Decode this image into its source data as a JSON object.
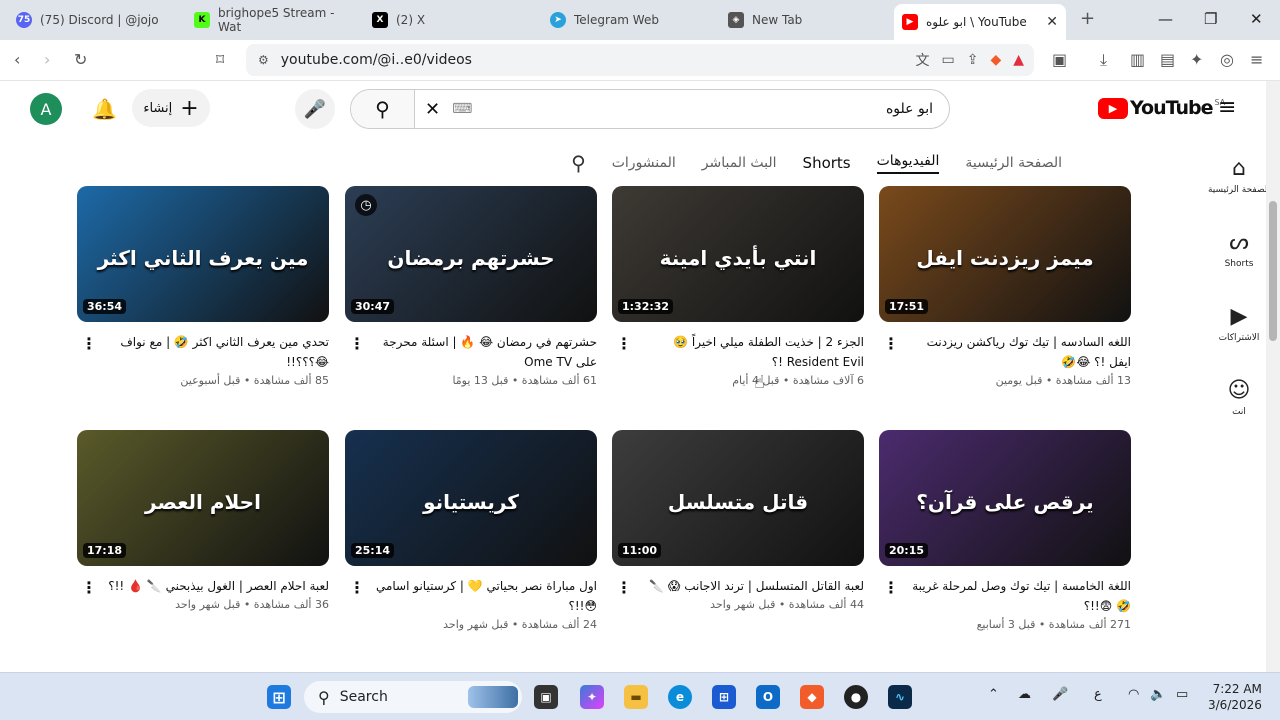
{
  "browser": {
    "tabs": [
      {
        "label": "(75) Discord | @jojo",
        "color": "#5865f2",
        "glyph": "75"
      },
      {
        "label": "brighope5 Stream - Wat",
        "color": "#1c1c1c",
        "glyph": "K"
      },
      {
        "label": "(2) X",
        "color": "#000000",
        "glyph": "X"
      },
      {
        "label": "Telegram Web",
        "color": "#2aa1da",
        "glyph": "➤"
      },
      {
        "label": "New Tab",
        "color": "#555555",
        "glyph": "◈"
      },
      {
        "label": "ابو علوه \\ YouTube",
        "color": "#ff0000",
        "glyph": "▶"
      }
    ],
    "url": "youtube.com/@i..e0/videos",
    "new_tab_glyph": "+"
  },
  "youtube": {
    "logo": "YouTube",
    "region": "SA",
    "search_value": "ابو علوه",
    "create_label": "إنشاء",
    "avatar_letter": "A",
    "channel_tabs": [
      "الصفحة الرئيسية",
      "الفيديوهات",
      "Shorts",
      "البث المباشر",
      "المنشورات"
    ],
    "sidebar": [
      {
        "label": "الصفحة الرئيسية",
        "icon": "⌂"
      },
      {
        "label": "Shorts",
        "icon": "ᔕ"
      },
      {
        "label": "الاشتراكات",
        "icon": "▶"
      },
      {
        "label": "انت",
        "icon": "☺"
      }
    ],
    "videos": [
      {
        "title": "اللغه السادسه | تيك توك رياكشن ريزدنت ايفل !؟ 😂🤣",
        "meta": "13 ألف مشاهدة • قبل يومين",
        "duration": "17:51",
        "overlay": "ميمز ريزدنت ايفل",
        "bg": "#7a4a1c"
      },
      {
        "title": "الجزء 2 | خذيت الطفلة ميلي اخيراً 🥹 Resident Evil !؟",
        "meta": "6 آلاف مشاهدة • قبل 4 أيام",
        "duration": "1:32:32",
        "overlay": "انتي بأيدي امينة",
        "bg": "#3e3a34"
      },
      {
        "title": "حشرتهم في رمضان 😂 🔥 | اسئلة محرجة على Ome TV",
        "meta": "61 ألف مشاهدة • قبل 13 يومًا",
        "duration": "30:47",
        "overlay": "حشرتهم برمضان",
        "bg": "#2c3e55"
      },
      {
        "title": "تحدي مين يعرف الثاني اكثر 🤣 | مع نواف 😂؟؟؟!!",
        "meta": "85 ألف مشاهدة • قبل أسبوعين",
        "duration": "36:54",
        "overlay": "مين يعرف الثاني اكثر",
        "bg": "#1d6aa8"
      },
      {
        "title": "اللغة الخامسة | تيك توك وصل لمرحلة غريبة 🤣 😨!!؟",
        "meta": "271 ألف مشاهدة • قبل 3 أسابيع",
        "duration": "20:15",
        "overlay": "يرقص على قرآن؟",
        "bg": "#4b2b6e"
      },
      {
        "title": "لعبة القاتل المتسلسل | ترند الاجانب 😱 🔪",
        "meta": "44 ألف مشاهدة • قبل شهر واحد",
        "duration": "11:00",
        "overlay": "قاتل متسلسل",
        "bg": "#3d3d3d"
      },
      {
        "title": "اول مباراة نصر بحياتي 💛 | كرستيانو اسامي 😳!!؟",
        "meta": "24 ألف مشاهدة • قبل شهر واحد",
        "duration": "25:14",
        "overlay": "كريستيانو",
        "bg": "#16304f"
      },
      {
        "title": "لعبة احلام العصر | الغول بيذبحني 🔪 🩸 !!؟",
        "meta": "36 ألف مشاهدة • قبل شهر واحد",
        "duration": "17:18",
        "overlay": "احلام العصر",
        "bg": "#5a5a2a"
      }
    ]
  },
  "taskbar": {
    "search_label": "Search",
    "time": "7:22 AM",
    "date": "3/6/2026",
    "lang": "ع"
  }
}
